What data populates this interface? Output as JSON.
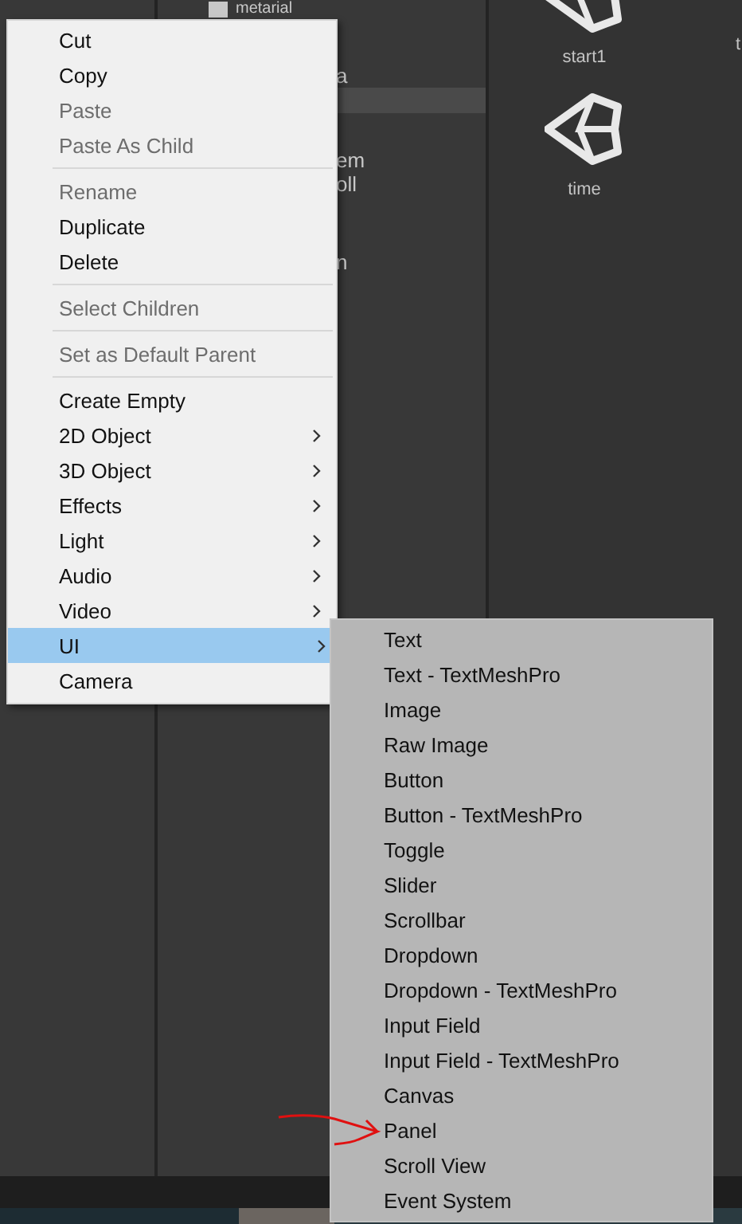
{
  "hierarchy": {
    "folder": "metarial",
    "fragments": [
      {
        "text": "a"
      },
      {
        "text": "em"
      },
      {
        "text": "oll"
      },
      {
        "text": "n"
      }
    ],
    "highlighted_row": true
  },
  "assets": [
    {
      "label": "start1"
    },
    {
      "label": "time"
    },
    {
      "label": "t"
    }
  ],
  "context_menu": [
    {
      "kind": "item",
      "label": "Cut",
      "disabled": false,
      "submenu": false,
      "selected": false
    },
    {
      "kind": "item",
      "label": "Copy",
      "disabled": false,
      "submenu": false,
      "selected": false
    },
    {
      "kind": "item",
      "label": "Paste",
      "disabled": true,
      "submenu": false,
      "selected": false
    },
    {
      "kind": "item",
      "label": "Paste As Child",
      "disabled": true,
      "submenu": false,
      "selected": false
    },
    {
      "kind": "separator"
    },
    {
      "kind": "item",
      "label": "Rename",
      "disabled": true,
      "submenu": false,
      "selected": false
    },
    {
      "kind": "item",
      "label": "Duplicate",
      "disabled": false,
      "submenu": false,
      "selected": false
    },
    {
      "kind": "item",
      "label": "Delete",
      "disabled": false,
      "submenu": false,
      "selected": false
    },
    {
      "kind": "separator"
    },
    {
      "kind": "item",
      "label": "Select Children",
      "disabled": true,
      "submenu": false,
      "selected": false
    },
    {
      "kind": "separator"
    },
    {
      "kind": "item",
      "label": "Set as Default Parent",
      "disabled": true,
      "submenu": false,
      "selected": false
    },
    {
      "kind": "separator"
    },
    {
      "kind": "item",
      "label": "Create Empty",
      "disabled": false,
      "submenu": false,
      "selected": false
    },
    {
      "kind": "item",
      "label": "2D Object",
      "disabled": false,
      "submenu": true,
      "selected": false
    },
    {
      "kind": "item",
      "label": "3D Object",
      "disabled": false,
      "submenu": true,
      "selected": false
    },
    {
      "kind": "item",
      "label": "Effects",
      "disabled": false,
      "submenu": true,
      "selected": false
    },
    {
      "kind": "item",
      "label": "Light",
      "disabled": false,
      "submenu": true,
      "selected": false
    },
    {
      "kind": "item",
      "label": "Audio",
      "disabled": false,
      "submenu": true,
      "selected": false
    },
    {
      "kind": "item",
      "label": "Video",
      "disabled": false,
      "submenu": true,
      "selected": false
    },
    {
      "kind": "item",
      "label": "UI",
      "disabled": false,
      "submenu": true,
      "selected": true
    },
    {
      "kind": "item",
      "label": "Camera",
      "disabled": false,
      "submenu": false,
      "selected": false
    }
  ],
  "ui_submenu": [
    {
      "label": "Text",
      "selected": false
    },
    {
      "label": "Text - TextMeshPro",
      "selected": false
    },
    {
      "label": "Image",
      "selected": false
    },
    {
      "label": "Raw Image",
      "selected": false
    },
    {
      "label": "Button",
      "selected": false
    },
    {
      "label": "Button - TextMeshPro",
      "selected": false
    },
    {
      "label": "Toggle",
      "selected": false
    },
    {
      "label": "Slider",
      "selected": false
    },
    {
      "label": "Scrollbar",
      "selected": false
    },
    {
      "label": "Dropdown",
      "selected": false
    },
    {
      "label": "Dropdown - TextMeshPro",
      "selected": false
    },
    {
      "label": "Input Field",
      "selected": false
    },
    {
      "label": "Input Field - TextMeshPro",
      "selected": false
    },
    {
      "label": "Canvas",
      "selected": false
    },
    {
      "label": "Panel",
      "selected": false,
      "annotated": true
    },
    {
      "label": "Scroll View",
      "selected": false
    },
    {
      "label": "Event System",
      "selected": false
    }
  ]
}
